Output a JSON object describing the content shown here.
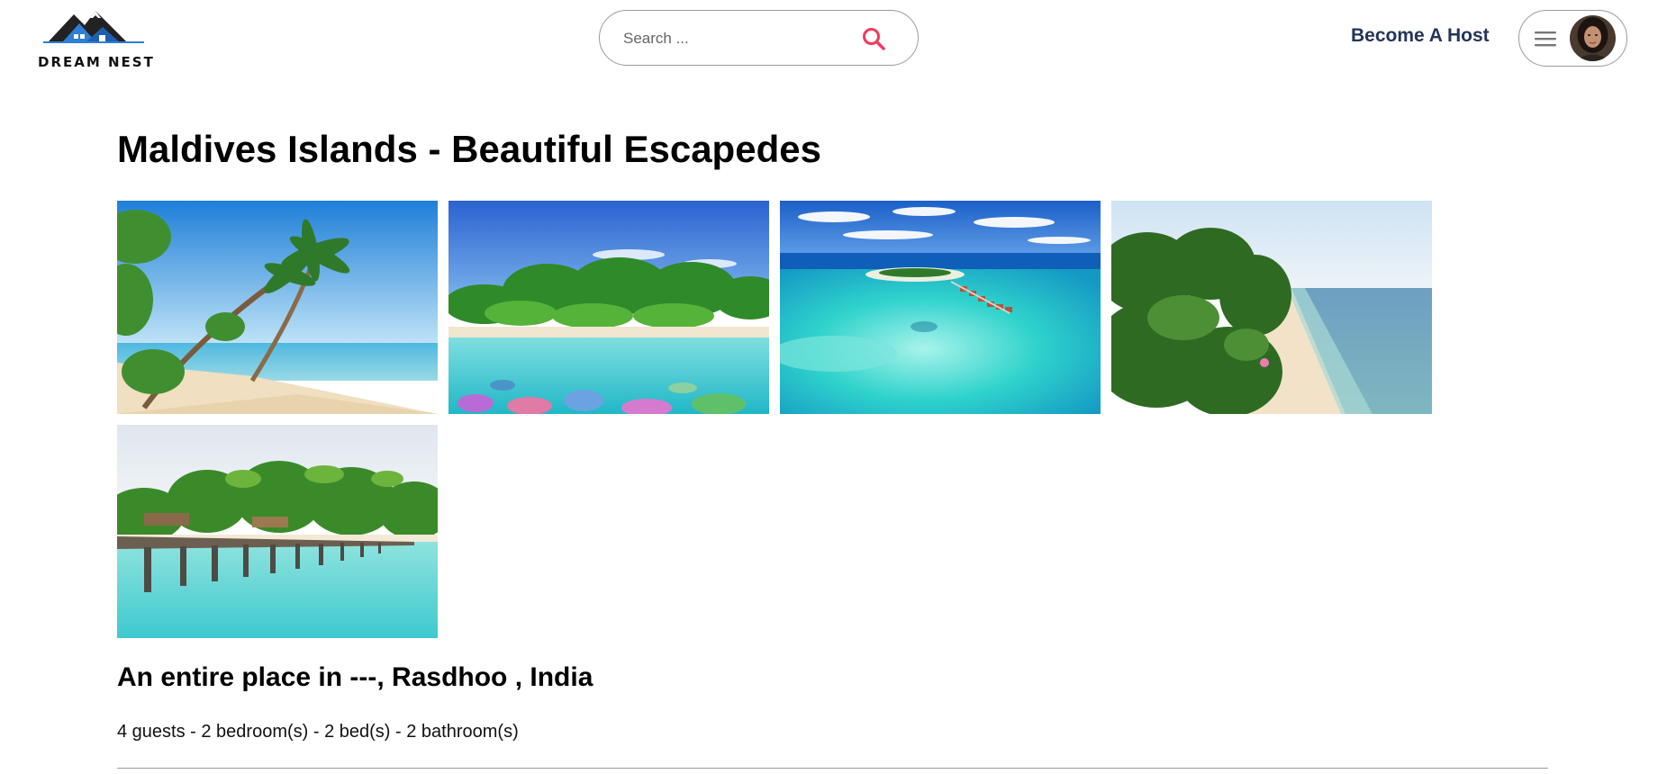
{
  "header": {
    "logo_text": "DREAM NEST",
    "search": {
      "placeholder": "Search ...",
      "icon": "search-icon"
    },
    "host_link": "Become A Host",
    "account_menu": {
      "menu_icon": "hamburger-menu-icon",
      "avatar": "user-avatar"
    }
  },
  "listing": {
    "title": "Maldives Islands - Beautiful Escapedes",
    "photos": [
      "beach-palm-trees",
      "island-coral-reef",
      "aerial-resort-lagoon",
      "aerial-beach-forest",
      "overwater-pier-resort"
    ],
    "place_heading": "An entire place in ---, Rasdhoo , India",
    "details": "4 guests - 2 bedroom(s) - 2 bed(s) - 2 bathroom(s)"
  },
  "colors": {
    "brand_dark": "#24355a",
    "accent_pink": "#f5385d",
    "logo_blue": "#2f7fd6",
    "border_gray": "#9a9a9a"
  }
}
